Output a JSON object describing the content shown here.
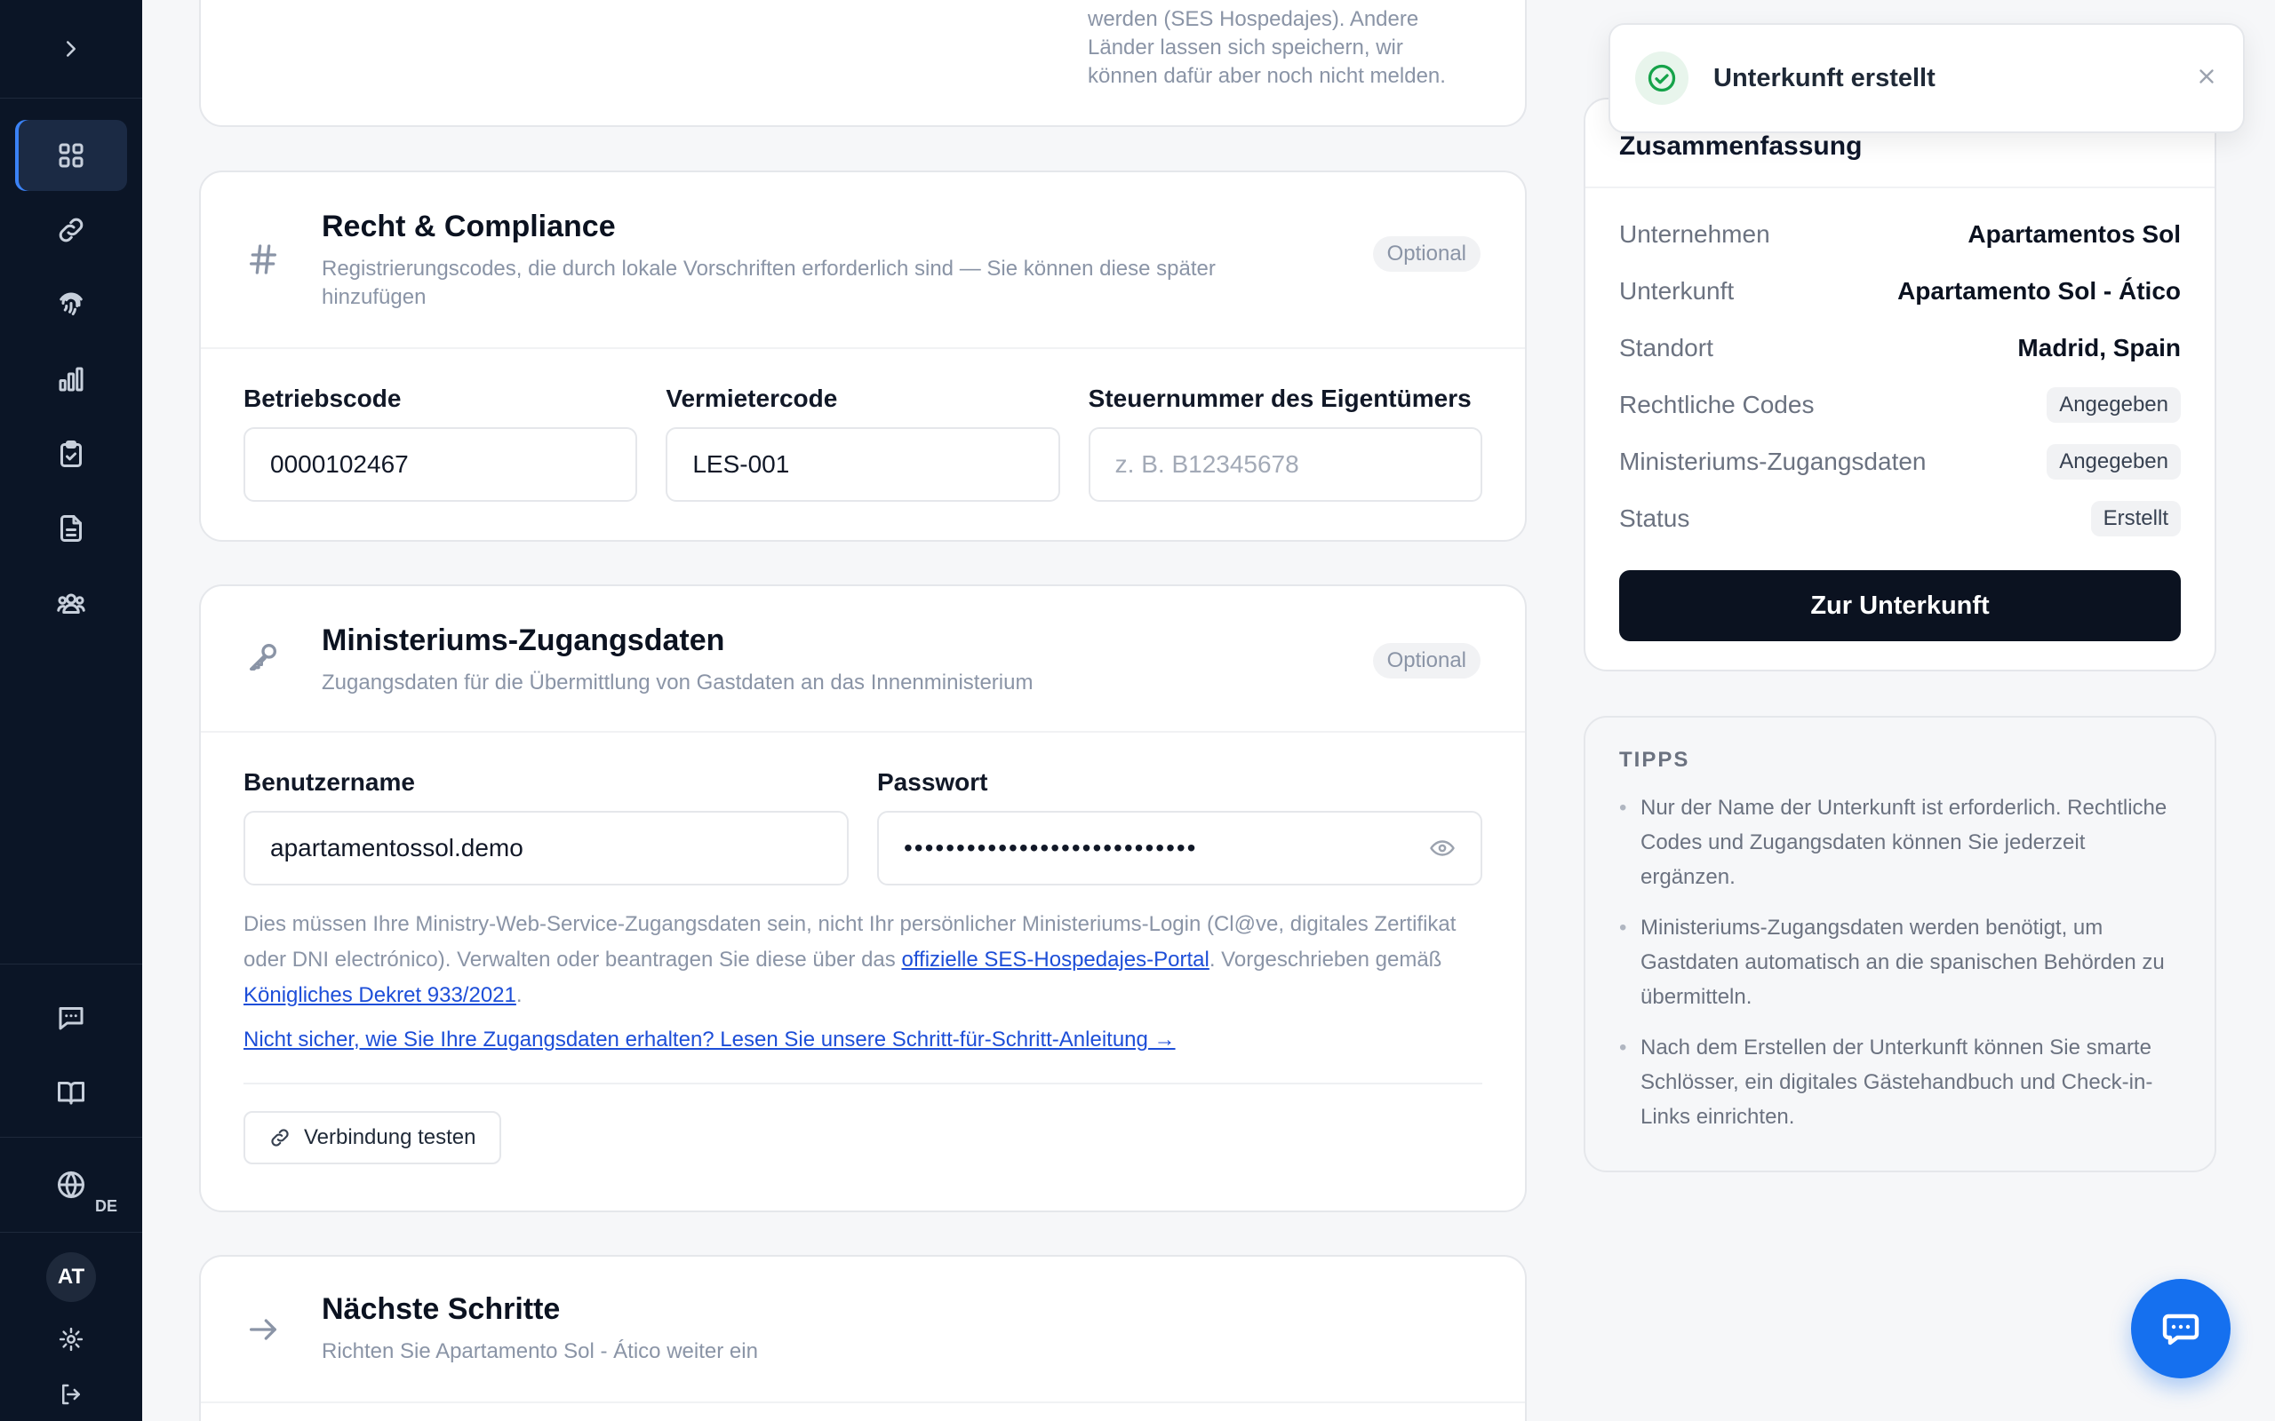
{
  "sidebar": {
    "language_code": "DE",
    "avatar_initials": "AT"
  },
  "location_card": {
    "note_lines": [
      "werden (SES Hospedajes). Andere",
      "Länder lassen sich speichern, wir",
      "können dafür aber noch nicht melden."
    ]
  },
  "legal": {
    "title": "Recht & Compliance",
    "subtitle": "Registrierungscodes, die durch lokale Vorschriften erforderlich sind — Sie können diese später hinzufügen",
    "badge": "Optional",
    "fields": [
      {
        "label": "Betriebscode",
        "value": "0000102467",
        "placeholder": ""
      },
      {
        "label": "Vermietercode",
        "value": "LES-001",
        "placeholder": ""
      },
      {
        "label": "Steuernummer des Eigentümers",
        "value": "",
        "placeholder": "z. B. B12345678"
      }
    ]
  },
  "ministry": {
    "title": "Ministeriums-Zugangsdaten",
    "subtitle": "Zugangsdaten für die Übermittlung von Gastdaten an das Innenministerium",
    "badge": "Optional",
    "username_label": "Benutzername",
    "username_value": "apartamentossol.demo",
    "password_label": "Passwort",
    "password_mask": "••••••••••••••••••••••••••••",
    "help_text_1": "Dies müssen Ihre Ministry-Web-Service-Zugangsdaten sein, nicht Ihr persönlicher Ministeriums-Login (Cl@ve, digitales Zertifikat oder DNI electrónico). Verwalten oder beantragen Sie diese über das ",
    "help_link_1": "offizielle SES-Hospedajes-Portal",
    "help_text_2": ". Vorgeschrieben gemäß ",
    "help_link_2": "Königliches Dekret 933/2021",
    "help_text_3": ".",
    "guide_link": "Nicht sicher, wie Sie Ihre Zugangsdaten erhalten? Lesen Sie unsere Schritt-für-Schritt-Anleitung →",
    "test_button": "Verbindung testen"
  },
  "next_steps": {
    "title": "Nächste Schritte",
    "subtitle": "Richten Sie Apartamento Sol - Ático weiter ein"
  },
  "toast": {
    "message": "Unterkunft erstellt"
  },
  "summary": {
    "title": "Zusammenfassung",
    "rows": [
      {
        "key": "Unternehmen",
        "value": "Apartamentos Sol"
      },
      {
        "key": "Unterkunft",
        "value": "Apartamento Sol - Ático"
      },
      {
        "key": "Standort",
        "value": "Madrid, Spain"
      },
      {
        "key": "Rechtliche Codes",
        "value": "Angegeben"
      },
      {
        "key": "Ministeriums-Zugangsdaten",
        "value": "Angegeben"
      },
      {
        "key": "Status",
        "value": "Erstellt"
      }
    ],
    "button": "Zur Unterkunft"
  },
  "tips": {
    "title": "TIPPS",
    "items": [
      "Nur der Name der Unterkunft ist erforderlich. Rechtliche Codes und Zugangsdaten können Sie jederzeit ergänzen.",
      "Ministeriums-Zugangsdaten werden benötigt, um Gastdaten automatisch an die spanischen Behörden zu übermitteln.",
      "Nach dem Erstellen der Unterkunft können Sie smarte Schlösser, ein digitales Gästehandbuch und Check-in-Links einrichten."
    ]
  }
}
